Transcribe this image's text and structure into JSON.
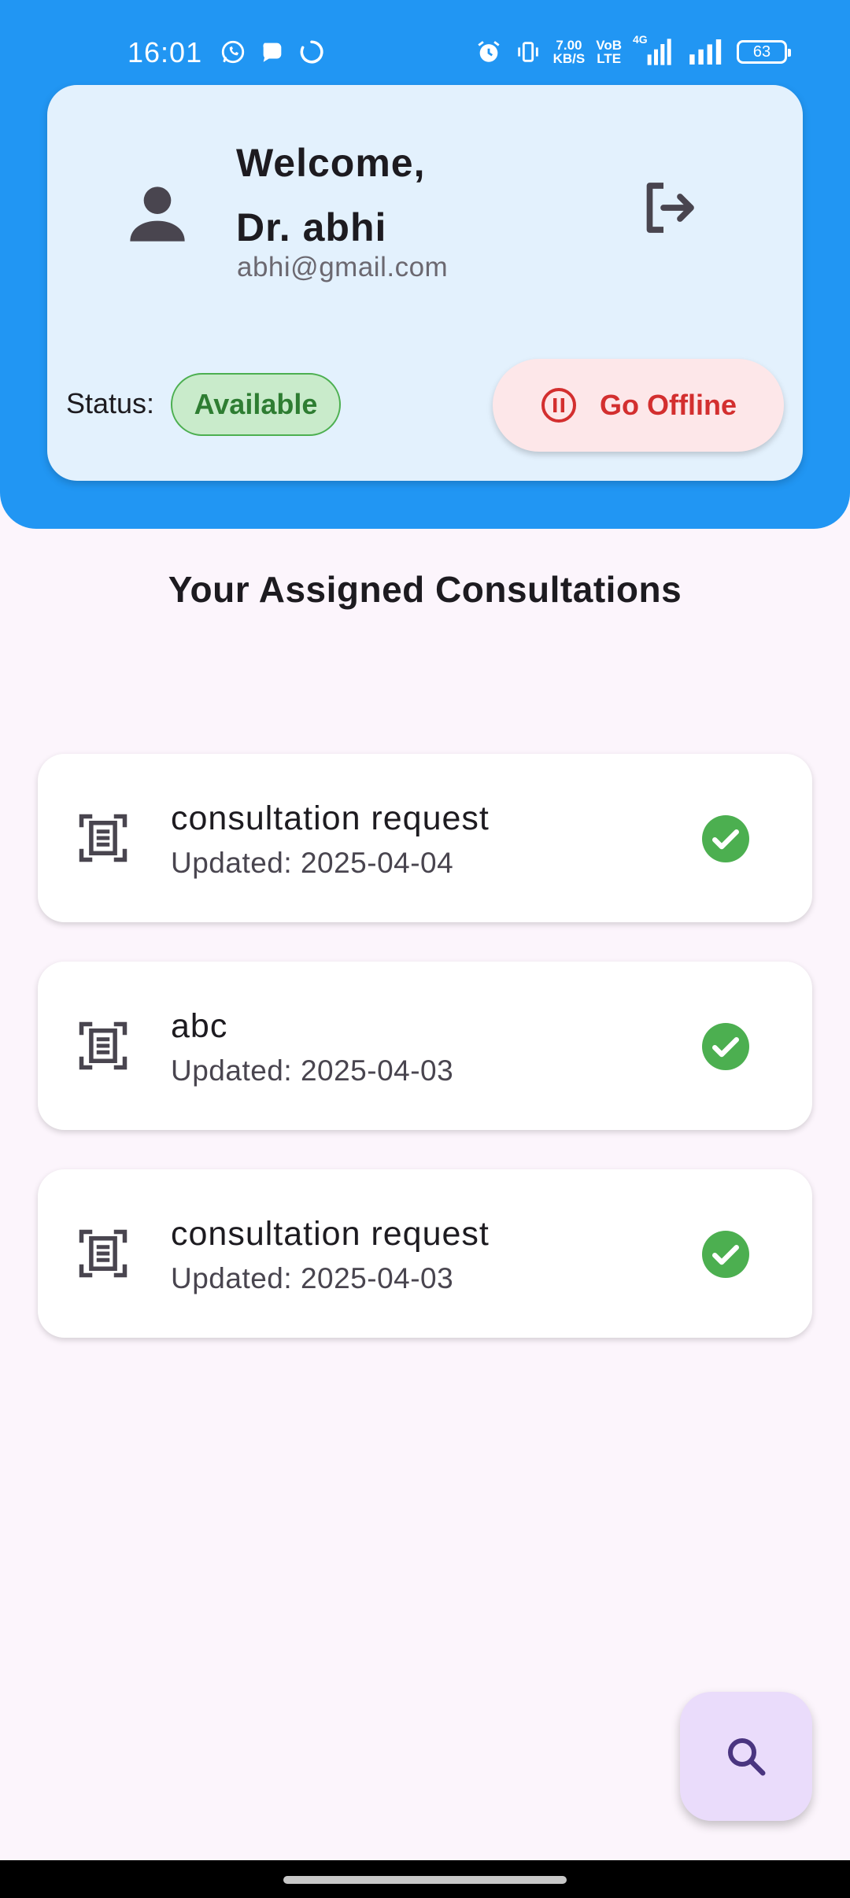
{
  "status_bar": {
    "time": "16:01",
    "net_speed_value": "7.00",
    "net_speed_unit": "KB/S",
    "volte": "VoB",
    "volte_sub": "LTE",
    "network_type": "4G",
    "battery": "63",
    "left_icons": [
      "whatsapp-icon",
      "chat-bubble-icon",
      "sync-spinner-icon"
    ],
    "right_icons": [
      "alarm-icon",
      "vibrate-icon",
      "signal-bars-icon",
      "signal-bars-icon"
    ]
  },
  "profile": {
    "welcome": "Welcome,",
    "doctor_name": "Dr. abhi",
    "email": "abhi@gmail.com",
    "status_label": "Status:",
    "status_value": "Available",
    "offline_button": "Go Offline"
  },
  "section_title": "Your Assigned Consultations",
  "consultations": [
    {
      "title": "consultation request",
      "updated": "Updated: 2025-04-04"
    },
    {
      "title": "abc",
      "updated": "Updated: 2025-04-03"
    },
    {
      "title": "consultation request",
      "updated": "Updated: 2025-04-03"
    }
  ],
  "colors": {
    "header": "#2196f3",
    "card": "#e3f1fd",
    "available": "#2e7d32",
    "offline": "#d32f2f",
    "check": "#4caf50",
    "fab": "#eadcfb"
  }
}
